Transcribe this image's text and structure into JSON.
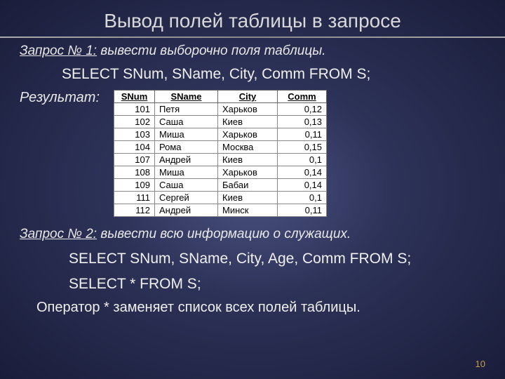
{
  "title": "Вывод полей таблицы в запросе",
  "query1": {
    "label": "Запрос № 1:",
    "text": " вывести выборочно поля таблицы.",
    "sql": "SELECT SNum, SName, City, Comm FROM  S;"
  },
  "result_label": "Результат:",
  "table": {
    "headers": [
      "SNum",
      "SName",
      "City",
      "Comm"
    ],
    "rows": [
      {
        "snum": "101",
        "sname": "Петя",
        "city": "Харьков",
        "comm": "0,12"
      },
      {
        "snum": "102",
        "sname": "Саша",
        "city": "Киев",
        "comm": "0,13"
      },
      {
        "snum": "103",
        "sname": "Миша",
        "city": "Харьков",
        "comm": "0,11"
      },
      {
        "snum": "104",
        "sname": "Рома",
        "city": "Москва",
        "comm": "0,15"
      },
      {
        "snum": "107",
        "sname": "Андрей",
        "city": "Киев",
        "comm": "0,1"
      },
      {
        "snum": "108",
        "sname": "Миша",
        "city": "Харьков",
        "comm": "0,14"
      },
      {
        "snum": "109",
        "sname": "Саша",
        "city": "Бабаи",
        "comm": "0,14"
      },
      {
        "snum": "111",
        "sname": "Сергей",
        "city": "Киев",
        "comm": "0,1"
      },
      {
        "snum": "112",
        "sname": "Андрей",
        "city": "Минск",
        "comm": "0,11"
      }
    ]
  },
  "query2": {
    "label": "Запрос № 2:",
    "text": " вывести всю информацию о служащих.",
    "sql1": "SELECT SNum, SName, City, Age, Comm FROM  S;",
    "sql2": "SELECT * FROM  S;"
  },
  "note": "Оператор  *   заменяет список всех полей таблицы.",
  "page": "10"
}
